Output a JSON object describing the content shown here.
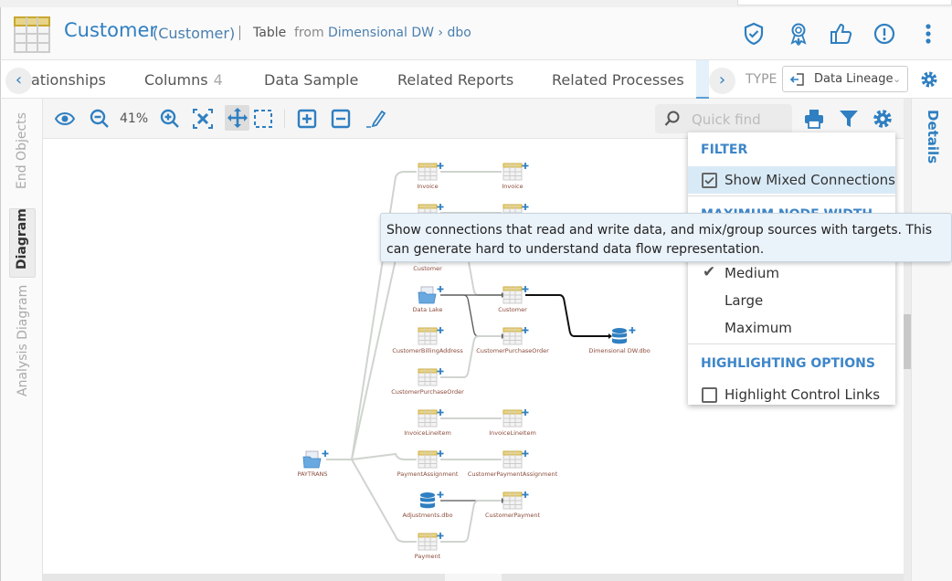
{
  "header": {
    "title": "Customer",
    "subtitle": "(Customer)",
    "kind": "Table",
    "from": "from",
    "path": "Dimensional DW › dbo",
    "icons": [
      "shield-check-icon",
      "award-icon",
      "thumbs-up-icon",
      "alert-icon",
      "more-vertical-icon"
    ]
  },
  "tabs": {
    "items": [
      {
        "label": "ationships"
      },
      {
        "label": "Columns",
        "count": "4"
      },
      {
        "label": "Data Sample"
      },
      {
        "label": "Related Reports"
      },
      {
        "label": "Related Processes"
      }
    ],
    "type_label": "TYPE",
    "type_value": "Data Lineage"
  },
  "side_tabs": [
    {
      "label": "End Objects"
    },
    {
      "label": "Diagram"
    },
    {
      "label": "Analysis Diagram"
    }
  ],
  "toolbar": {
    "zoom": "41%",
    "quick_find_placeholder": "Quick find"
  },
  "details_label": "Details",
  "menu": {
    "filter_header": "FILTER",
    "show_mixed": "Show Mixed Connections",
    "show_mixed_checked": true,
    "node_width_header": "MAXIMUM NODE WIDTH",
    "medium": "Medium",
    "large": "Large",
    "maximum": "Maximum",
    "selected_width": "Medium",
    "highlight_header": "HIGHLIGHTING OPTIONS",
    "highlight_control": "Highlight Control Links",
    "highlight_checked": false
  },
  "tooltip": "Show connections that read and write data, and mix/group sources with targets. This can generate hard to understand data flow representation.",
  "colors": {
    "accent": "#2f7fc1",
    "table_header": "#e8d488",
    "highlight": "#d9eaf7"
  },
  "diagram": {
    "nodes": [
      {
        "name": "PAYTRANS",
        "type": "folder"
      },
      {
        "name": "Invoice",
        "type": "table"
      },
      {
        "name": "Invoice",
        "type": "table"
      },
      {
        "name": "",
        "type": "table"
      },
      {
        "name": "",
        "type": "table"
      },
      {
        "name": "Customer",
        "type": "table"
      },
      {
        "name": "Data Lake",
        "type": "folder"
      },
      {
        "name": "CustomerBillingAddress",
        "type": "table"
      },
      {
        "name": "CustomerPurchaseOrder",
        "type": "table"
      },
      {
        "name": "InvoiceLineItem",
        "type": "table"
      },
      {
        "name": "PaymentAssignment",
        "type": "table"
      },
      {
        "name": "Adjustments.dbo",
        "type": "database"
      },
      {
        "name": "Payment",
        "type": "table"
      },
      {
        "name": "Customer",
        "type": "table"
      },
      {
        "name": "CustomerPurchaseOrder",
        "type": "table"
      },
      {
        "name": "InvoiceLineItem",
        "type": "table"
      },
      {
        "name": "CustomerPaymentAssignment",
        "type": "table"
      },
      {
        "name": "CustomerPayment",
        "type": "table"
      },
      {
        "name": "Dimensional DW.dbo",
        "type": "database"
      }
    ],
    "edges": [
      {
        "from": 1,
        "to": 2,
        "style": "light"
      },
      {
        "from": 3,
        "to": 4,
        "style": "light"
      },
      {
        "from": 5,
        "to": 13,
        "style": "light"
      },
      {
        "from": 6,
        "to": 13,
        "style": "dark"
      },
      {
        "from": 6,
        "to": 14,
        "style": "dark"
      },
      {
        "from": 8,
        "to": 14,
        "style": "light"
      },
      {
        "from": 9,
        "to": 15,
        "style": "light"
      },
      {
        "from": 10,
        "to": 16,
        "style": "light"
      },
      {
        "from": 11,
        "to": 17,
        "style": "dark"
      },
      {
        "from": 12,
        "to": 17,
        "style": "light"
      },
      {
        "from": 13,
        "to": 18,
        "style": "bold"
      }
    ]
  }
}
